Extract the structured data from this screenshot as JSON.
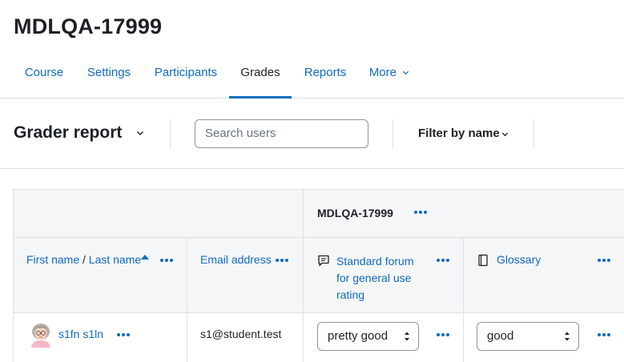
{
  "course": {
    "title": "MDLQA-17999"
  },
  "nav": {
    "items": [
      {
        "label": "Course"
      },
      {
        "label": "Settings"
      },
      {
        "label": "Participants"
      },
      {
        "label": "Grades"
      },
      {
        "label": "Reports"
      },
      {
        "label": "More"
      }
    ],
    "active": "Grades"
  },
  "toolbar": {
    "report_title": "Grader report",
    "search_placeholder": "Search users",
    "filter_label": "Filter by name"
  },
  "table": {
    "category": "MDLQA-17999",
    "headers": {
      "first_name": "First name",
      "separator": "/",
      "last_name": "Last name",
      "email": "Email address",
      "forum_line1": "Standard forum",
      "forum_line2": "for general use",
      "forum_line3": "rating",
      "glossary": "Glossary"
    },
    "rows": [
      {
        "name": "s1fn s1ln",
        "email": "s1@student.test",
        "forum_grade": "pretty good",
        "glossary_grade": "good"
      }
    ]
  },
  "colors": {
    "link": "#0f6cbf",
    "border": "#dee2e6",
    "header_bg": "#f5f6f7",
    "text": "#1d2125"
  },
  "icons": [
    "chevron-down-icon",
    "more-dots-icon",
    "sort-ascending-icon",
    "forum-icon",
    "glossary-icon",
    "select-updown-icon"
  ]
}
